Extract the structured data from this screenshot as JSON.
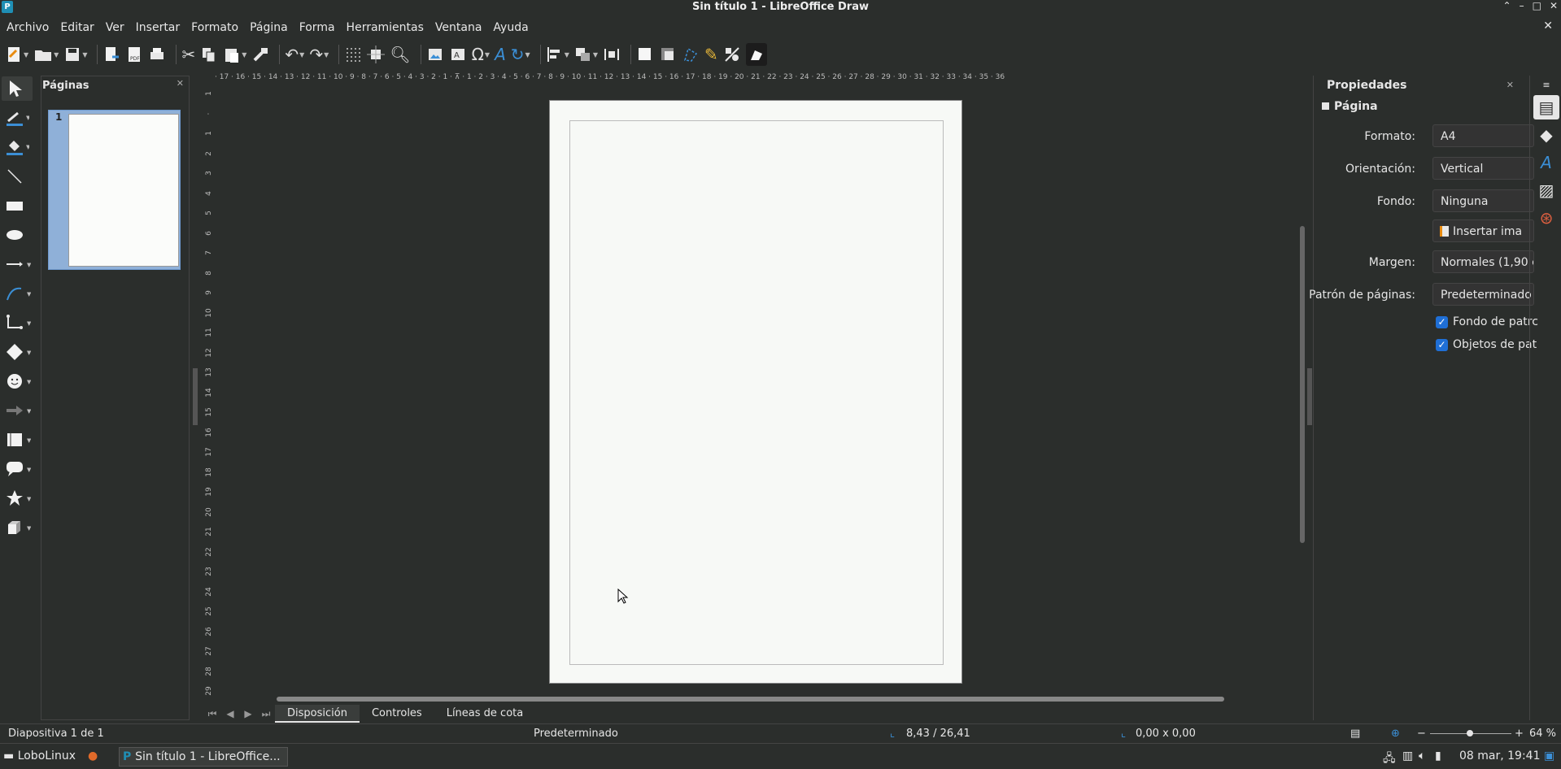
{
  "window": {
    "title": "Sin título 1 - LibreOffice Draw",
    "app_icon": "libreoffice-draw-icon"
  },
  "menu": [
    "Archivo",
    "Editar",
    "Ver",
    "Insertar",
    "Formato",
    "Página",
    "Forma",
    "Herramientas",
    "Ventana",
    "Ayuda"
  ],
  "pages_panel": {
    "title": "Páginas",
    "page_number": "1"
  },
  "ruler_h": "· 17 · 16 · 15 · 14 · 13 · 12 · 11 · 10 · 9 · 8 · 7 · 6 · 5 · 4 · 3 · 2 · 1 · ⊼ · 1 · 2 · 3 · 4 · 5 · 6 · 7 · 8 · 9 · 10 · 11 · 12 · 13 · 14 · 15 · 16 · 17 · 18 · 19 · 20 · 21 · 22 · 23 · 24 · 25 · 26 · 27 · 28 · 29 · 30 · 31 · 32 · 33 · 34 · 35 · 36",
  "ruler_v": [
    "1",
    "·",
    "1",
    "2",
    "3",
    "4",
    "5",
    "6",
    "7",
    "8",
    "9",
    "10",
    "11",
    "12",
    "13",
    "14",
    "15",
    "16",
    "17",
    "18",
    "19",
    "20",
    "21",
    "22",
    "23",
    "24",
    "25",
    "26",
    "27",
    "28",
    "29"
  ],
  "tabs": {
    "layout": "Disposición",
    "controls": "Controles",
    "dimension": "Líneas de cota"
  },
  "sidebar": {
    "title": "Propiedades",
    "section": "Página",
    "format_label": "Formato:",
    "format_value": "A4",
    "orientation_label": "Orientación:",
    "orientation_value": "Vertical",
    "background_label": "Fondo:",
    "background_value": "Ninguna",
    "insert_image": "Insertar ima",
    "margin_label": "Margen:",
    "margin_value": "Normales (1,90 c",
    "master_label": "Patrón de páginas:",
    "master_value": "Predeterminado",
    "master_bg": "Fondo de patrc",
    "master_objects": "Objetos de pat"
  },
  "status": {
    "slide": "Diapositiva 1 de 1",
    "master": "Predeterminado",
    "position": "8,43 / 26,41",
    "size": "0,00 x 0,00",
    "zoom": "64 %",
    "zoom_level": 0.45
  },
  "taskbar": {
    "start": "LoboLinux",
    "task": "Sin título 1 - LibreOffice...",
    "clock": "08 mar, 19:41"
  },
  "colors": {
    "accent": "#1f6fd6",
    "page": "#f7f9f6",
    "bg": "#2b2e2c"
  }
}
